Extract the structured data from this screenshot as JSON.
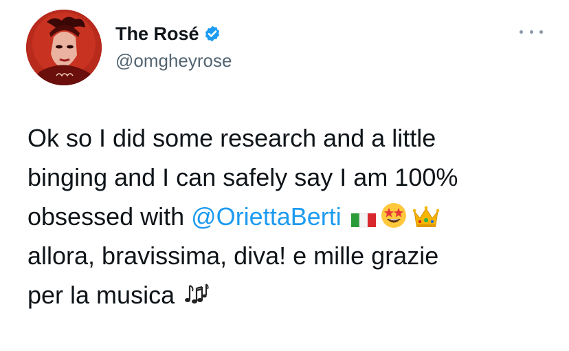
{
  "author": {
    "display_name": "The Rosé",
    "handle": "@omgheyrose",
    "verified": true,
    "avatar_icon": "profile-photo"
  },
  "menu": {
    "icon": "more-options-icon"
  },
  "tweet": {
    "line1": "Ok so I did some research and a little",
    "line2": "binging and I can safely say I am 100%",
    "line3_prefix": "obsessed with ",
    "mention": "@OriettaBerti",
    "line4": "allora, bravissima, diva! e mille grazie",
    "line5": "per la musica",
    "emojis": {
      "flag": "italy-flag-emoji",
      "face": "star-struck-emoji",
      "crown": "crown-emoji",
      "notes": "musical-notes-emoji"
    }
  },
  "colors": {
    "link": "#1d9bf0",
    "verified": "#1d9bf0",
    "secondary_text": "#536471"
  }
}
